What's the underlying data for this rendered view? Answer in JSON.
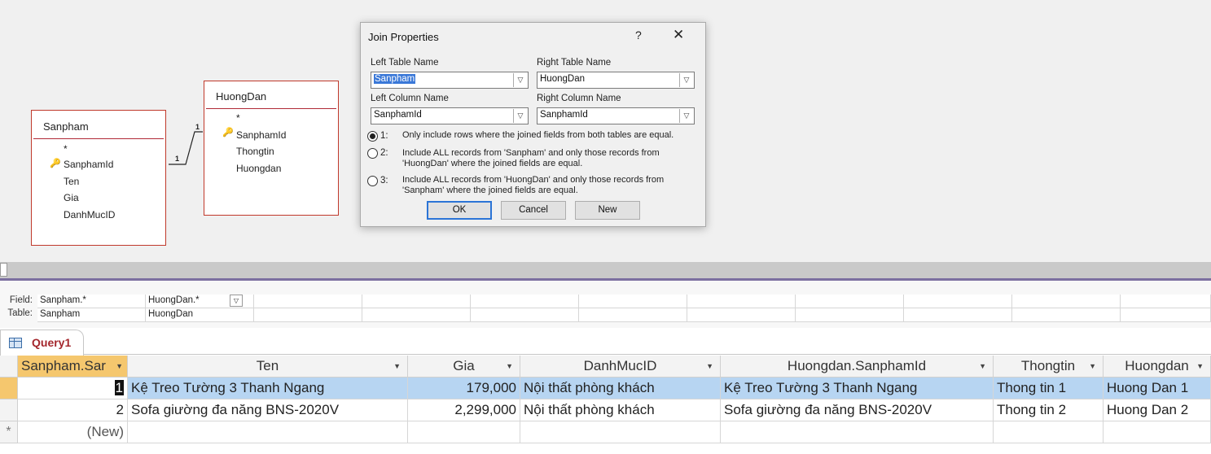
{
  "design": {
    "tables": [
      {
        "name": "Sanpham",
        "fields": [
          "*",
          "SanphamId",
          "Ten",
          "Gia",
          "DanhMucID"
        ]
      },
      {
        "name": "HuongDan",
        "fields": [
          "*",
          "SanphamId",
          "Thongtin",
          "Huongdan"
        ]
      }
    ],
    "join_labels": [
      "1",
      "1"
    ]
  },
  "dialog": {
    "title": "Join Properties",
    "help_label": "?",
    "close_label": "✕",
    "left_table_label": "Left Table Name",
    "left_table_value": "Sanpham",
    "right_table_label": "Right Table Name",
    "right_table_value": "HuongDan",
    "left_column_label": "Left Column Name",
    "left_column_value": "SanphamId",
    "right_column_label": "Right Column Name",
    "right_column_value": "SanphamId",
    "options": [
      {
        "num": "1:",
        "text": "Only include rows where the joined fields from both tables are equal.",
        "checked": true
      },
      {
        "num": "2:",
        "text": "Include ALL records from 'Sanpham' and only those records from 'HuongDan' where the joined fields are equal.",
        "checked": false
      },
      {
        "num": "3:",
        "text": "Include ALL records from 'HuongDan' and only those records from 'Sanpham' where the joined fields are equal.",
        "checked": false
      }
    ],
    "buttons": {
      "ok": "OK",
      "cancel": "Cancel",
      "new": "New"
    }
  },
  "qbe": {
    "field_label": "Field:",
    "table_label": "Table:",
    "columns": [
      {
        "field": "Sanpham.*",
        "table": "Sanpham"
      },
      {
        "field": "HuongDan.*",
        "table": "HuongDan"
      }
    ]
  },
  "query_tab": {
    "name": "Query1"
  },
  "datasheet": {
    "headers": [
      "Sanpham.Sar",
      "Ten",
      "Gia",
      "DanhMucID",
      "Huongdan.SanphamId",
      "Thongtin",
      "Huongdan"
    ],
    "rows": [
      [
        "1",
        "Kệ Treo Tường 3 Thanh Ngang",
        "179,000",
        "Nội thất phòng khách",
        "Kệ Treo Tường 3 Thanh Ngang",
        "Thong tin 1",
        "Huong Dan 1"
      ],
      [
        "2",
        "Sofa giường đa năng BNS-2020V",
        "2,299,000",
        "Nội thất phòng khách",
        "Sofa giường đa năng BNS-2020V",
        "Thong tin 2",
        "Huong Dan 2"
      ]
    ],
    "new_row_label": "(New)",
    "new_row_marker": "*"
  },
  "colors": {
    "table_border": "#c0392b",
    "accent_blue": "#2b74d6",
    "selected_header": "#f5c76e",
    "selected_row": "#b7d5f2",
    "tab_text": "#a4262c"
  }
}
